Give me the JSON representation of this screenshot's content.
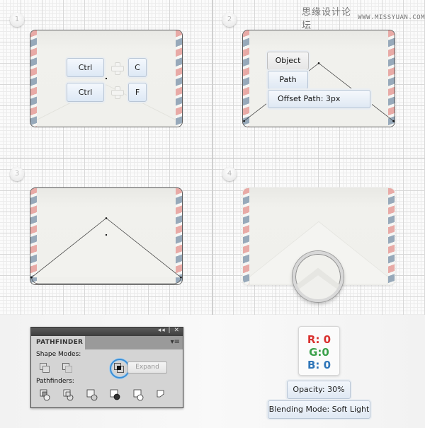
{
  "watermark": {
    "site_name": "思缘设计论坛",
    "url": "WWW.MISSYUAN.COM"
  },
  "steps": [
    {
      "number": "1",
      "shortcuts": [
        {
          "modifier": "Ctrl",
          "key": "C"
        },
        {
          "modifier": "Ctrl",
          "key": "F"
        }
      ]
    },
    {
      "number": "2",
      "menu_path": [
        "Object",
        "Path",
        "Offset Path: 3px"
      ]
    },
    {
      "number": "3"
    },
    {
      "number": "4"
    }
  ],
  "envelope_colors": {
    "paper": "#f0f0ec",
    "stripe_red": "#e8aaa6",
    "stripe_blue": "#97a9ba"
  },
  "pathfinder_panel": {
    "title": "PATHFINDER",
    "titlebar_controls": "◂◂ | ✕",
    "menu_icon": "▾≡",
    "shape_modes_label": "Shape Modes:",
    "shape_modes": [
      {
        "name": "unite",
        "selected": false
      },
      {
        "name": "minus-front",
        "selected": false
      },
      {
        "name": "intersect",
        "selected": true
      },
      {
        "name": "exclude",
        "selected": false
      }
    ],
    "expand_label": "Expand",
    "pathfinders_label": "Pathfinders:",
    "pathfinders": [
      "divide",
      "trim",
      "merge",
      "crop",
      "outline",
      "minus-back"
    ],
    "accent_color": "#3b8fd6"
  },
  "fill_settings": {
    "r_label": "R: 0",
    "g_label": "G:0",
    "b_label": "B: 0",
    "r_color": "#d9312f",
    "g_color": "#3aa04a",
    "b_color": "#2f76b9",
    "opacity_label": "Opacity: 30%",
    "blending_label": "Blending Mode: Soft Light"
  }
}
